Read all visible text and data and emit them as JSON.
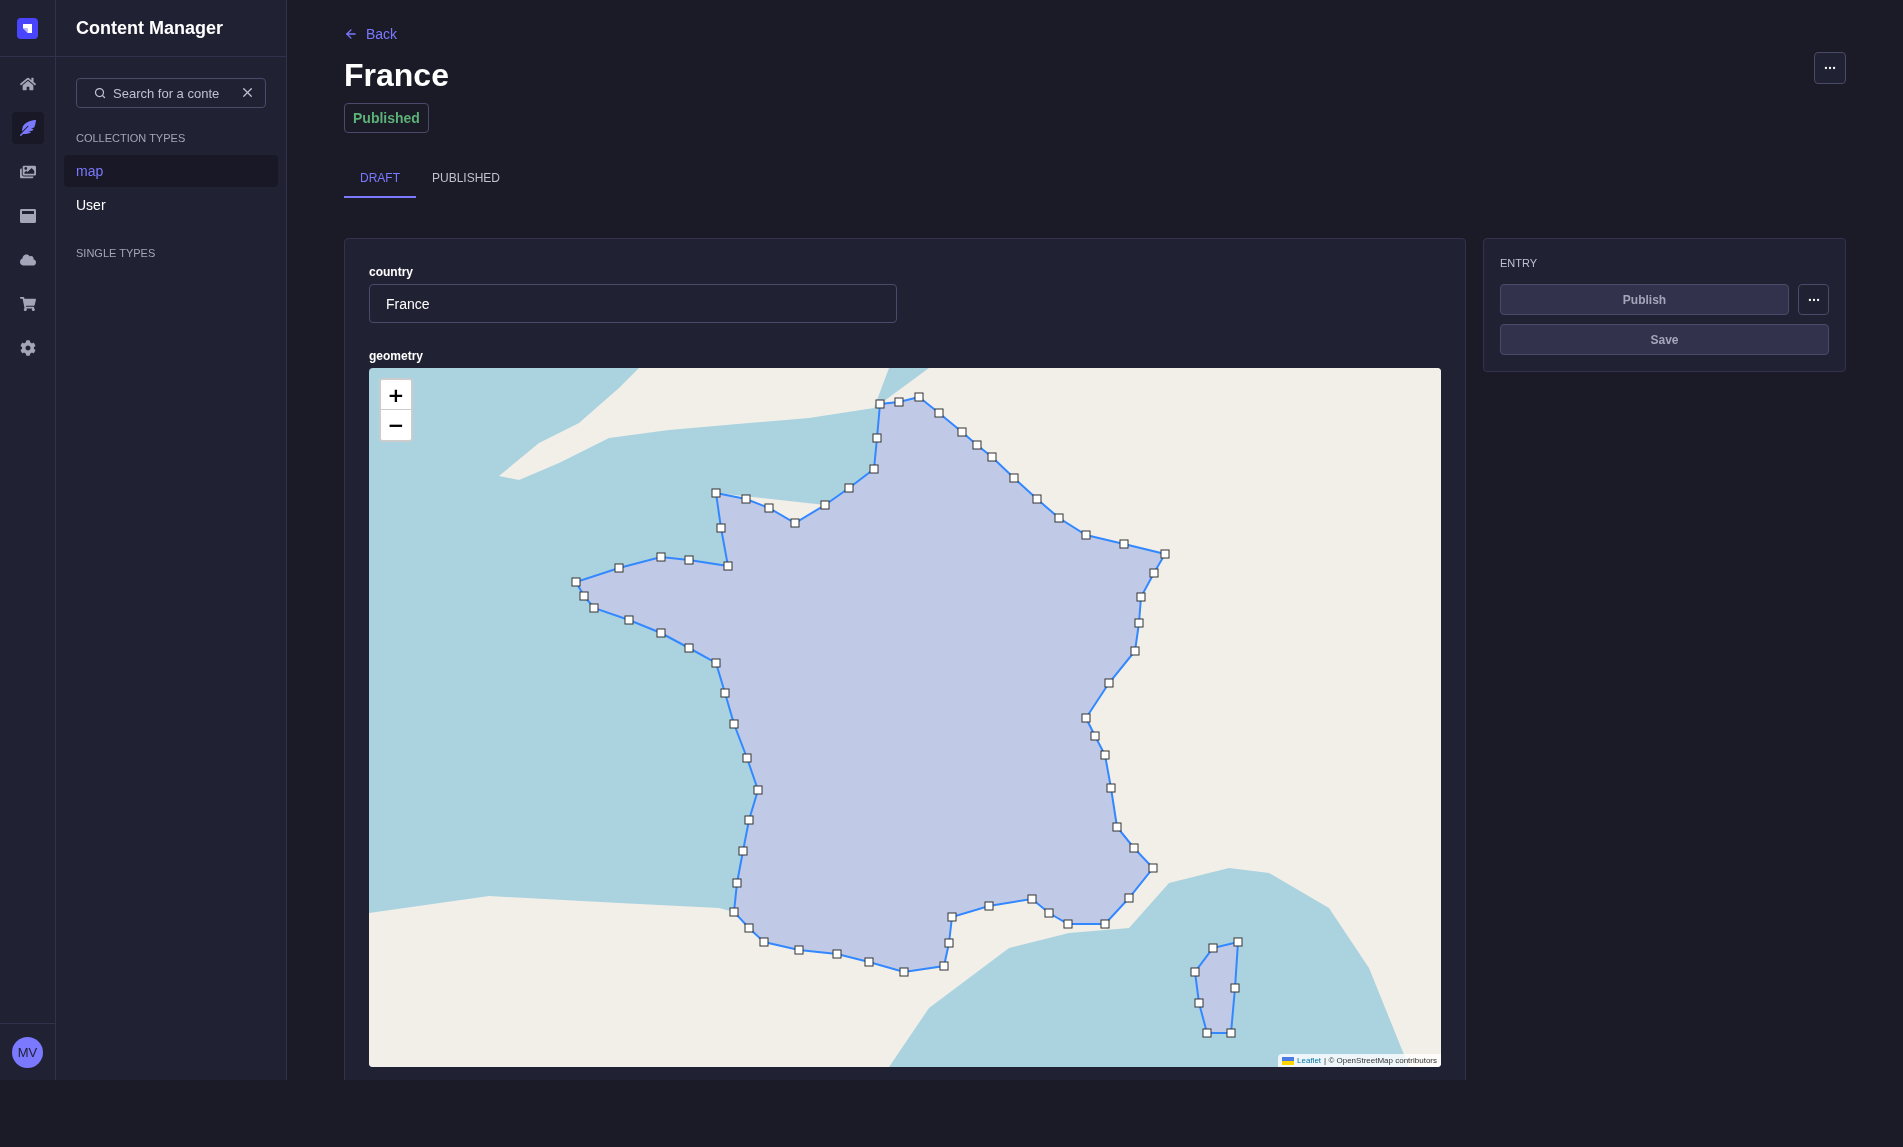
{
  "nav": {
    "items": [
      {
        "selected": false
      },
      {
        "selected": true
      },
      {
        "selected": false
      },
      {
        "selected": false
      },
      {
        "selected": false
      },
      {
        "selected": false
      },
      {
        "selected": false
      }
    ],
    "avatar": {
      "initials": "MV"
    }
  },
  "sidebar": {
    "title": "Content Manager",
    "search": {
      "placeholder": "Search for a conte"
    },
    "sections": [
      {
        "heading": "COLLECTION TYPES",
        "items": [
          {
            "label": "map",
            "selected": true
          },
          {
            "label": "User",
            "selected": false
          }
        ]
      },
      {
        "heading": "SINGLE TYPES"
      }
    ]
  },
  "header": {
    "back": "Back",
    "title": "France",
    "status": "Published"
  },
  "tabs": [
    {
      "label": "DRAFT",
      "selected": true
    },
    {
      "label": "PUBLISHED",
      "selected": false
    }
  ],
  "form": {
    "fields": [
      {
        "kind": "text",
        "label": "country",
        "value": "France"
      },
      {
        "kind": "map",
        "label": "geometry",
        "zoom_in": "+",
        "zoom_out": "−",
        "attribution_link": "Leaflet",
        "attribution": "| © OpenStreetMap contributors"
      }
    ]
  },
  "entry": {
    "heading": "ENTRY",
    "buttons": [
      {
        "label": "Publish",
        "disabled": true
      },
      {
        "label": "Save",
        "disabled": true
      }
    ]
  }
}
